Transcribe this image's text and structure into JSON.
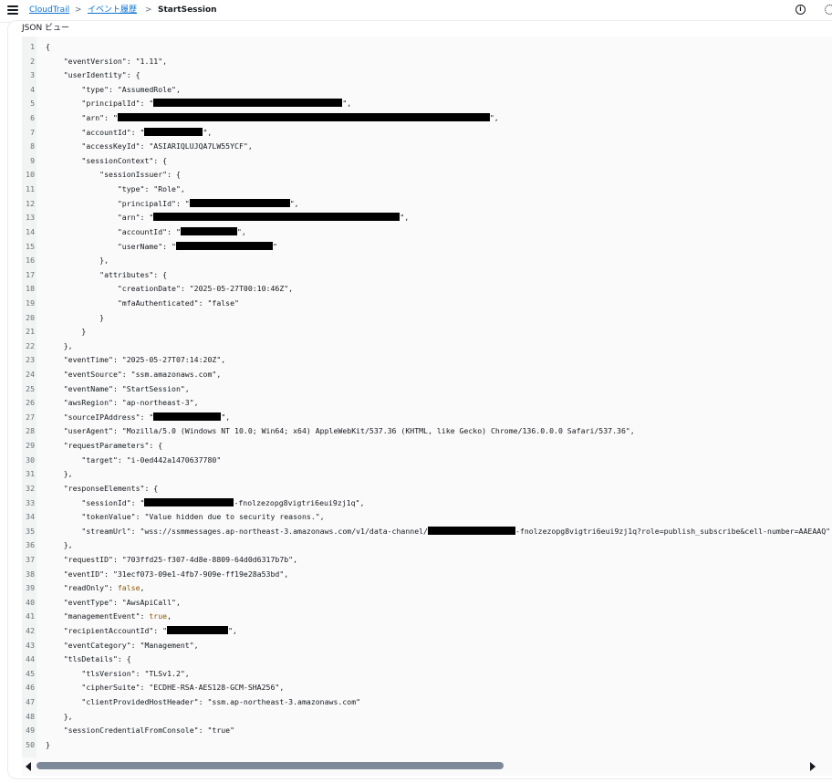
{
  "breadcrumb": {
    "root": "CloudTrail",
    "history": "イベント履歴",
    "current": "StartSession",
    "sep": ">"
  },
  "info_icon_glyph": "i",
  "section_title": "JSON ビュー",
  "code_lines": [
    {
      "n": "1",
      "parts": [
        {
          "t": "{"
        }
      ]
    },
    {
      "n": "2",
      "parts": [
        {
          "t": "    \"eventVersion\": \"1.11\","
        }
      ]
    },
    {
      "n": "3",
      "parts": [
        {
          "t": "    \"userIdentity\": {"
        }
      ]
    },
    {
      "n": "4",
      "parts": [
        {
          "t": "        \"type\": \"AssumedRole\","
        }
      ]
    },
    {
      "n": "5",
      "parts": [
        {
          "t": "        \"principalId\": \""
        },
        {
          "r": "principal"
        },
        {
          "t": "\","
        }
      ]
    },
    {
      "n": "6",
      "parts": [
        {
          "t": "        \"arn\": \""
        },
        {
          "r": "arn-long"
        },
        {
          "t": "\","
        }
      ]
    },
    {
      "n": "7",
      "parts": [
        {
          "t": "        \"accountId\": \""
        },
        {
          "r": "account"
        },
        {
          "t": "\","
        }
      ]
    },
    {
      "n": "8",
      "parts": [
        {
          "t": "        \"accessKeyId\": \"ASIARIQLUJQA7LW55YCF\","
        }
      ]
    },
    {
      "n": "9",
      "parts": [
        {
          "t": "        \"sessionContext\": {"
        }
      ]
    },
    {
      "n": "10",
      "parts": [
        {
          "t": "            \"sessionIssuer\": {"
        }
      ]
    },
    {
      "n": "11",
      "parts": [
        {
          "t": "                \"type\": \"Role\","
        }
      ]
    },
    {
      "n": "12",
      "parts": [
        {
          "t": "                \"principalId\": \""
        },
        {
          "r": "principal2"
        },
        {
          "t": "\","
        }
      ]
    },
    {
      "n": "13",
      "parts": [
        {
          "t": "                \"arn\": \""
        },
        {
          "r": "arn2"
        },
        {
          "t": "\","
        }
      ]
    },
    {
      "n": "14",
      "parts": [
        {
          "t": "                \"accountId\": \""
        },
        {
          "r": "account2"
        },
        {
          "t": "\","
        }
      ]
    },
    {
      "n": "15",
      "parts": [
        {
          "t": "                \"userName\": \""
        },
        {
          "r": "username"
        },
        {
          "t": "\""
        }
      ]
    },
    {
      "n": "16",
      "parts": [
        {
          "t": "            },"
        }
      ]
    },
    {
      "n": "17",
      "parts": [
        {
          "t": "            \"attributes\": {"
        }
      ]
    },
    {
      "n": "18",
      "parts": [
        {
          "t": "                \"creationDate\": \"2025-05-27T00:10:46Z\","
        }
      ]
    },
    {
      "n": "19",
      "parts": [
        {
          "t": "                \"mfaAuthenticated\": \"false\""
        }
      ]
    },
    {
      "n": "20",
      "parts": [
        {
          "t": "            }"
        }
      ]
    },
    {
      "n": "21",
      "parts": [
        {
          "t": "        }"
        }
      ]
    },
    {
      "n": "22",
      "parts": [
        {
          "t": "    },"
        }
      ]
    },
    {
      "n": "23",
      "parts": [
        {
          "t": "    \"eventTime\": \"2025-05-27T07:14:20Z\","
        }
      ]
    },
    {
      "n": "24",
      "parts": [
        {
          "t": "    \"eventSource\": \"ssm.amazonaws.com\","
        }
      ]
    },
    {
      "n": "25",
      "parts": [
        {
          "t": "    \"eventName\": \"StartSession\","
        }
      ]
    },
    {
      "n": "26",
      "parts": [
        {
          "t": "    \"awsRegion\": \"ap-northeast-3\","
        }
      ]
    },
    {
      "n": "27",
      "parts": [
        {
          "t": "    \"sourceIPAddress\": \""
        },
        {
          "r": "ip"
        },
        {
          "t": "\","
        }
      ]
    },
    {
      "n": "28",
      "parts": [
        {
          "t": "    \"userAgent\": \"Mozilla/5.0 (Windows NT 10.0; Win64; x64) AppleWebKit/537.36 (KHTML, like Gecko) Chrome/136.0.0.0 Safari/537.36\","
        }
      ]
    },
    {
      "n": "29",
      "parts": [
        {
          "t": "    \"requestParameters\": {"
        }
      ]
    },
    {
      "n": "30",
      "parts": [
        {
          "t": "        \"target\": \"i-0ed442a1470637780\""
        }
      ]
    },
    {
      "n": "31",
      "parts": [
        {
          "t": "    },"
        }
      ]
    },
    {
      "n": "32",
      "parts": [
        {
          "t": "    \"responseElements\": {"
        }
      ]
    },
    {
      "n": "33",
      "parts": [
        {
          "t": "        \"sessionId\": \""
        },
        {
          "r": "session"
        },
        {
          "t": "-fnolzezopg8vigtri6eui9zj1q\","
        }
      ]
    },
    {
      "n": "34",
      "parts": [
        {
          "t": "        \"tokenValue\": \"Value hidden due to security reasons.\","
        }
      ]
    },
    {
      "n": "35",
      "parts": [
        {
          "t": "        \"streamUrl\": \"wss://ssmmessages.ap-northeast-3.amazonaws.com/v1/data-channel/"
        },
        {
          "r": "stream"
        },
        {
          "t": "-fnolzezopg8vigtri6eui9zj1q?role=publish_subscribe&cell-number=AAEAAQ\""
        }
      ]
    },
    {
      "n": "36",
      "parts": [
        {
          "t": "    },"
        }
      ]
    },
    {
      "n": "37",
      "parts": [
        {
          "t": "    \"requestID\": \"703ffd25-f307-4d8e-8809-64d0d6317b7b\","
        }
      ]
    },
    {
      "n": "38",
      "parts": [
        {
          "t": "    \"eventID\": \"31ecf073-09e1-4fb7-909e-ff19e28a53bd\","
        }
      ]
    },
    {
      "n": "39",
      "parts": [
        {
          "t": "    \"readOnly\": "
        },
        {
          "kw": "false"
        },
        {
          "t": ","
        }
      ]
    },
    {
      "n": "40",
      "parts": [
        {
          "t": "    \"eventType\": \"AwsApiCall\","
        }
      ]
    },
    {
      "n": "41",
      "parts": [
        {
          "t": "    \"managementEvent\": "
        },
        {
          "kw": "true"
        },
        {
          "t": ","
        }
      ]
    },
    {
      "n": "42",
      "parts": [
        {
          "t": "    \"recipientAccountId\": \""
        },
        {
          "r": "account3"
        },
        {
          "t": "\","
        }
      ]
    },
    {
      "n": "43",
      "parts": [
        {
          "t": "    \"eventCategory\": \"Management\","
        }
      ]
    },
    {
      "n": "44",
      "parts": [
        {
          "t": "    \"tlsDetails\": {"
        }
      ]
    },
    {
      "n": "45",
      "parts": [
        {
          "t": "        \"tlsVersion\": \"TLSv1.2\","
        }
      ]
    },
    {
      "n": "46",
      "parts": [
        {
          "t": "        \"cipherSuite\": \"ECDHE-RSA-AES128-GCM-SHA256\","
        }
      ]
    },
    {
      "n": "47",
      "parts": [
        {
          "t": "        \"clientProvidedHostHeader\": \"ssm.ap-northeast-3.amazonaws.com\""
        }
      ]
    },
    {
      "n": "48",
      "parts": [
        {
          "t": "    },"
        }
      ]
    },
    {
      "n": "49",
      "parts": [
        {
          "t": "    \"sessionCredentialFromConsole\": \"true\""
        }
      ]
    },
    {
      "n": "50",
      "parts": [
        {
          "t": "}"
        }
      ]
    }
  ],
  "scroll": {
    "horizontal_position_fraction": 0.0,
    "horizontal_visible_fraction": 0.59
  }
}
